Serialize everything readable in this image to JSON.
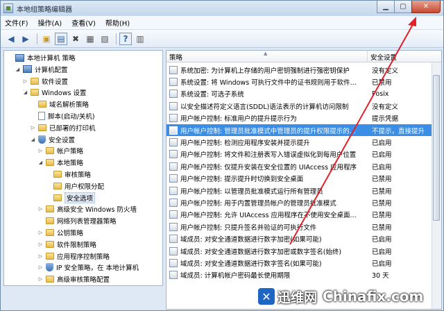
{
  "window": {
    "title": "本地组策略编辑器"
  },
  "menu": [
    "文件(F)",
    "操作(A)",
    "查看(V)",
    "帮助(H)"
  ],
  "tree": [
    {
      "label": "本地计算机 策略",
      "indent": 0,
      "icon": "computer-icon",
      "exp": ""
    },
    {
      "label": "计算机配置",
      "indent": 1,
      "icon": "computer-icon",
      "exp": "◢"
    },
    {
      "label": "软件设置",
      "indent": 2,
      "icon": "folder-icon",
      "exp": "▷"
    },
    {
      "label": "Windows 设置",
      "indent": 2,
      "icon": "folder-icon",
      "exp": "◢"
    },
    {
      "label": "域名解析策略",
      "indent": 3,
      "icon": "folder-icon",
      "exp": ""
    },
    {
      "label": "脚本(启动/关机)",
      "indent": 3,
      "icon": "doc-icon",
      "exp": ""
    },
    {
      "label": "已部署的打印机",
      "indent": 3,
      "icon": "folder-icon",
      "exp": "▷"
    },
    {
      "label": "安全设置",
      "indent": 3,
      "icon": "shield-icon",
      "exp": "◢"
    },
    {
      "label": "帐户策略",
      "indent": 4,
      "icon": "folder-icon",
      "exp": "▷"
    },
    {
      "label": "本地策略",
      "indent": 4,
      "icon": "folder-icon",
      "exp": "◢"
    },
    {
      "label": "审核策略",
      "indent": 5,
      "icon": "folder-icon",
      "exp": ""
    },
    {
      "label": "用户权限分配",
      "indent": 5,
      "icon": "folder-icon",
      "exp": ""
    },
    {
      "label": "安全选项",
      "indent": 5,
      "icon": "folder-icon",
      "exp": "",
      "selected": true
    },
    {
      "label": "高级安全 Windows 防火墙",
      "indent": 4,
      "icon": "folder-icon",
      "exp": "▷"
    },
    {
      "label": "网络列表管理器策略",
      "indent": 4,
      "icon": "folder-icon",
      "exp": ""
    },
    {
      "label": "公钥策略",
      "indent": 4,
      "icon": "folder-icon",
      "exp": "▷"
    },
    {
      "label": "软件限制策略",
      "indent": 4,
      "icon": "folder-icon",
      "exp": "▷"
    },
    {
      "label": "应用程序控制策略",
      "indent": 4,
      "icon": "folder-icon",
      "exp": "▷"
    },
    {
      "label": "IP 安全策略，在 本地计算机",
      "indent": 4,
      "icon": "shield-icon",
      "exp": "▷"
    },
    {
      "label": "高级审核策略配置",
      "indent": 4,
      "icon": "folder-icon",
      "exp": "▷"
    }
  ],
  "columns": {
    "policy": "策略",
    "setting": "安全设置"
  },
  "policies": [
    {
      "name": "系统加密: 为计算机上存储的用户密钥强制进行强密钥保护",
      "setting": "没有定义"
    },
    {
      "name": "系统设置: 将 Windows 可执行文件中的证书规则用于软件...",
      "setting": "已禁用"
    },
    {
      "name": "系统设置: 可选子系统",
      "setting": "Posix"
    },
    {
      "name": "以安全描述符定义语言(SDDL)语法表示的计算机访问限制",
      "setting": "没有定义"
    },
    {
      "name": "用户帐户控制: 标准用户的提升提示行为",
      "setting": "提示凭据"
    },
    {
      "name": "用户帐户控制: 管理员批准模式中管理员的提升权限提示的...",
      "setting": "不提示，直接提升",
      "highlight": true
    },
    {
      "name": "用户帐户控制: 检测应用程序安装并提示提升",
      "setting": "已启用"
    },
    {
      "name": "用户帐户控制: 将文件和注册表写入错误虚拟化到每用户位置",
      "setting": "已启用"
    },
    {
      "name": "用户帐户控制: 仅提升安装在安全位置的 UIAccess 应用程序",
      "setting": "已启用"
    },
    {
      "name": "用户帐户控制: 提示提升时切换到安全桌面",
      "setting": "已禁用"
    },
    {
      "name": "用户帐户控制: 以管理员批准模式运行所有管理员",
      "setting": "已禁用"
    },
    {
      "name": "用户帐户控制: 用于内置管理员帐户的管理员批准模式",
      "setting": "已禁用"
    },
    {
      "name": "用户帐户控制: 允许 UIAccess 应用程序在不使用安全桌面...",
      "setting": "已禁用"
    },
    {
      "name": "用户帐户控制: 只提升签名并验证的可执行文件",
      "setting": "已禁用"
    },
    {
      "name": "域成员: 对安全通道数据进行数字加密(如果可能)",
      "setting": "已启用"
    },
    {
      "name": "域成员: 对安全通道数据进行数字加密或数字签名(始终)",
      "setting": "已启用"
    },
    {
      "name": "域成员: 对安全通道数据进行数字签名(如果可能)",
      "setting": "已启用"
    },
    {
      "name": "域成员: 计算机帐户密码最长使用期限",
      "setting": "30 天"
    }
  ],
  "watermark": {
    "cn": "迅维网",
    "en": "Chinafix.com"
  }
}
